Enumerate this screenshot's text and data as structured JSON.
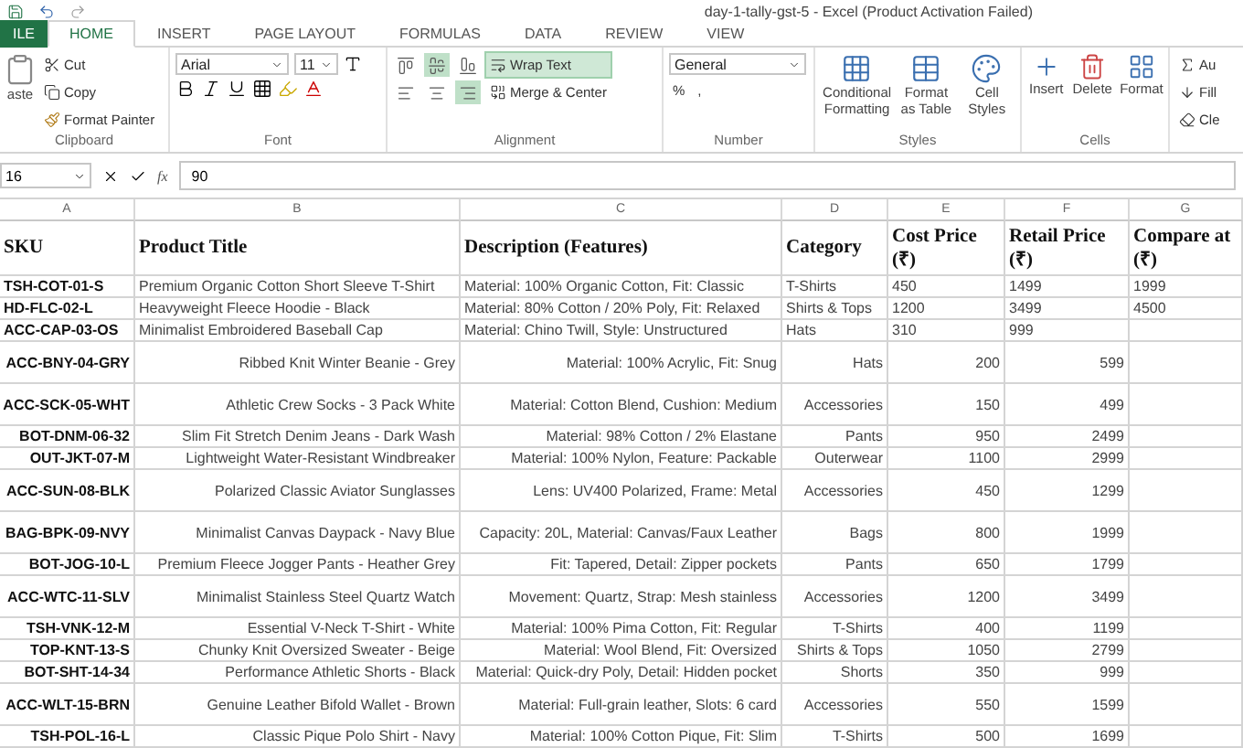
{
  "window": {
    "title": "day-1-tally-gst-5 - Excel (Product Activation Failed)"
  },
  "tabs": [
    {
      "label": "ILE",
      "kind": "file",
      "selected": false
    },
    {
      "label": "HOME",
      "kind": "tab",
      "selected": true
    },
    {
      "label": "INSERT",
      "kind": "tab",
      "selected": false
    },
    {
      "label": "PAGE LAYOUT",
      "kind": "tab",
      "selected": false
    },
    {
      "label": "FORMULAS",
      "kind": "tab",
      "selected": false
    },
    {
      "label": "DATA",
      "kind": "tab",
      "selected": false
    },
    {
      "label": "REVIEW",
      "kind": "tab",
      "selected": false
    },
    {
      "label": "VIEW",
      "kind": "tab",
      "selected": false
    }
  ],
  "ribbon": {
    "clipboard": {
      "label": "Clipboard",
      "paste": "aste",
      "cut": "Cut",
      "copy": "Copy",
      "format_painter": "Format Painter"
    },
    "font": {
      "label": "Font",
      "name": "Arial",
      "size": "11"
    },
    "alignment": {
      "label": "Alignment",
      "vertical": [
        {
          "selected": false
        },
        {
          "selected": true
        },
        {
          "selected": false
        }
      ],
      "horizontal": [
        {
          "selected": false
        },
        {
          "selected": false
        },
        {
          "selected": true
        }
      ],
      "wrap_text": {
        "label": "Wrap Text",
        "on": true
      },
      "merge": "Merge & Center"
    },
    "number": {
      "label": "Number",
      "format": "General",
      "percent": "%",
      "comma": ","
    },
    "styles": {
      "label": "Styles",
      "buttons": [
        "Conditional Formatting",
        "Format as Table",
        "Cell Styles"
      ]
    },
    "cells": {
      "label": "Cells",
      "buttons": [
        "Insert",
        "Delete",
        "Format"
      ]
    },
    "editing": [
      "Au",
      "Fill",
      "Cle"
    ]
  },
  "formula_bar": {
    "name_box": "16",
    "function_label": "fx",
    "value": "90"
  },
  "sheet": {
    "columns": [
      "A",
      "B",
      "C",
      "D",
      "E",
      "F",
      "G"
    ],
    "header": [
      "SKU",
      "Product Title",
      "Description (Features)",
      "Category",
      "Cost Price (₹)",
      "Retail Price (₹)",
      "Compare at (₹)"
    ],
    "rows": [
      {
        "kind": "left",
        "tall": false,
        "cells": [
          "TSH-COT-01-S",
          "Premium Organic Cotton Short Sleeve T-Shirt",
          "Material: 100% Organic Cotton, Fit: Classic",
          "T-Shirts",
          "450",
          "1499",
          "1999"
        ]
      },
      {
        "kind": "left",
        "tall": false,
        "cells": [
          "HD-FLC-02-L",
          "Heavyweight Fleece Hoodie - Black",
          "Material: 80% Cotton / 20% Poly, Fit: Relaxed",
          "Shirts & Tops",
          "1200",
          "3499",
          "4500"
        ]
      },
      {
        "kind": "left",
        "tall": false,
        "cells": [
          "ACC-CAP-03-OS",
          "Minimalist Embroidered Baseball Cap",
          "Material: Chino Twill, Style: Unstructured",
          "Hats",
          "310",
          "999"
        ]
      },
      {
        "kind": "right",
        "tall": true,
        "cells": [
          "ACC-BNY-04-GRY",
          "Ribbed Knit Winter Beanie - Grey",
          "Material: 100% Acrylic, Fit: Snug",
          "Hats",
          "200",
          "599"
        ]
      },
      {
        "kind": "right",
        "tall": true,
        "cells": [
          "ACC-SCK-05-WHT",
          "Athletic Crew Socks - 3 Pack White",
          "Material: Cotton Blend, Cushion: Medium",
          "Accessories",
          "150",
          "499"
        ]
      },
      {
        "kind": "right",
        "tall": false,
        "cells": [
          "BOT-DNM-06-32",
          "Slim Fit Stretch Denim Jeans - Dark Wash",
          "Material: 98% Cotton / 2% Elastane",
          "Pants",
          "950",
          "2499"
        ]
      },
      {
        "kind": "right",
        "tall": false,
        "cells": [
          "OUT-JKT-07-M",
          "Lightweight Water-Resistant Windbreaker",
          "Material: 100% Nylon, Feature: Packable",
          "Outerwear",
          "1100",
          "2999"
        ]
      },
      {
        "kind": "right",
        "tall": true,
        "cells": [
          "ACC-SUN-08-BLK",
          "Polarized Classic Aviator Sunglasses",
          "Lens: UV400 Polarized, Frame: Metal",
          "Accessories",
          "450",
          "1299"
        ]
      },
      {
        "kind": "right",
        "tall": true,
        "cells": [
          "BAG-BPK-09-NVY",
          "Minimalist Canvas Daypack - Navy Blue",
          "Capacity: 20L, Material: Canvas/Faux Leather",
          "Bags",
          "800",
          "1999"
        ]
      },
      {
        "kind": "right",
        "tall": false,
        "cells": [
          "BOT-JOG-10-L",
          "Premium Fleece Jogger Pants - Heather Grey",
          "Fit: Tapered, Detail: Zipper pockets",
          "Pants",
          "650",
          "1799"
        ]
      },
      {
        "kind": "right",
        "tall": true,
        "cells": [
          "ACC-WTC-11-SLV",
          "Minimalist Stainless Steel Quartz Watch",
          "Movement: Quartz, Strap: Mesh stainless",
          "Accessories",
          "1200",
          "3499"
        ]
      },
      {
        "kind": "right",
        "tall": false,
        "cells": [
          "TSH-VNK-12-M",
          "Essential V-Neck T-Shirt - White",
          "Material: 100% Pima Cotton, Fit: Regular",
          "T-Shirts",
          "400",
          "1199"
        ]
      },
      {
        "kind": "right",
        "tall": false,
        "cells": [
          "TOP-KNT-13-S",
          "Chunky Knit Oversized Sweater - Beige",
          "Material: Wool Blend, Fit: Oversized",
          "Shirts & Tops",
          "1050",
          "2799"
        ]
      },
      {
        "kind": "right",
        "tall": false,
        "cells": [
          "BOT-SHT-14-34",
          "Performance Athletic Shorts - Black",
          "Material: Quick-dry Poly, Detail: Hidden pocket",
          "Shorts",
          "350",
          "999"
        ]
      },
      {
        "kind": "right",
        "tall": true,
        "cells": [
          "ACC-WLT-15-BRN",
          "Genuine Leather Bifold Wallet - Brown",
          "Material: Full-grain leather, Slots: 6 card",
          "Accessories",
          "550",
          "1599"
        ]
      },
      {
        "kind": "right",
        "tall": false,
        "cells": [
          "TSH-POL-16-L",
          "Classic Pique Polo Shirt - Navy",
          "Material: 100% Cotton Pique, Fit: Slim",
          "T-Shirts",
          "500",
          "1699"
        ]
      }
    ]
  }
}
